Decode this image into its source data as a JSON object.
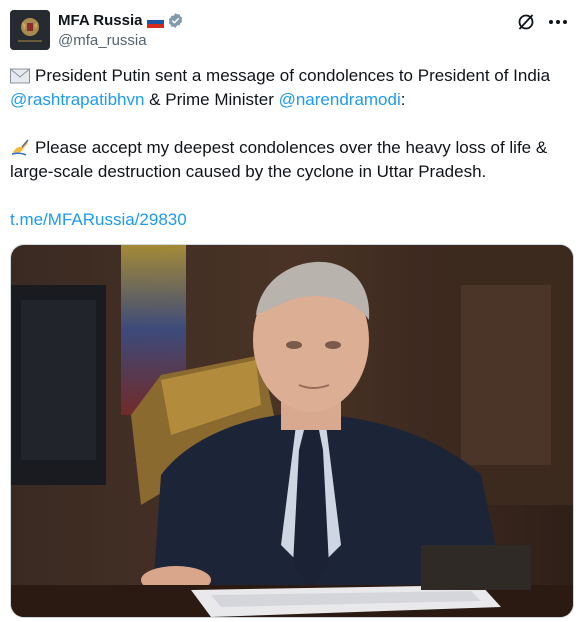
{
  "author": {
    "display_name": "MFA Russia",
    "handle": "@mfa_russia",
    "flag_icon": "russia-flag-icon",
    "verified_icon": "verified-badge-icon",
    "verified_color": "#829aab"
  },
  "actions": {
    "grok_icon": "grok-slash-icon",
    "more_icon": "more-dots-icon"
  },
  "tweet": {
    "line1_prefix": "President Putin sent a message of condolences to President of India",
    "mention1": "@rashtrapatibhvn",
    "line1_middle": " & Prime Minister ",
    "mention2": "@narendramodi",
    "line1_suffix": ":",
    "para2": "Please accept my deepest condolences over the heavy loss of life & large-scale destruction caused by the cyclone in Uttar Pradesh.",
    "link": "t.me/MFARussia/29830",
    "envelope_icon": "envelope-icon",
    "writing_hand_icon": "writing-hand-icon"
  },
  "media": {
    "photo_icon": "photo-of-man-at-desk"
  },
  "colors": {
    "link": "#1d9bf0",
    "text": "#0f1419",
    "secondary": "#536471"
  }
}
